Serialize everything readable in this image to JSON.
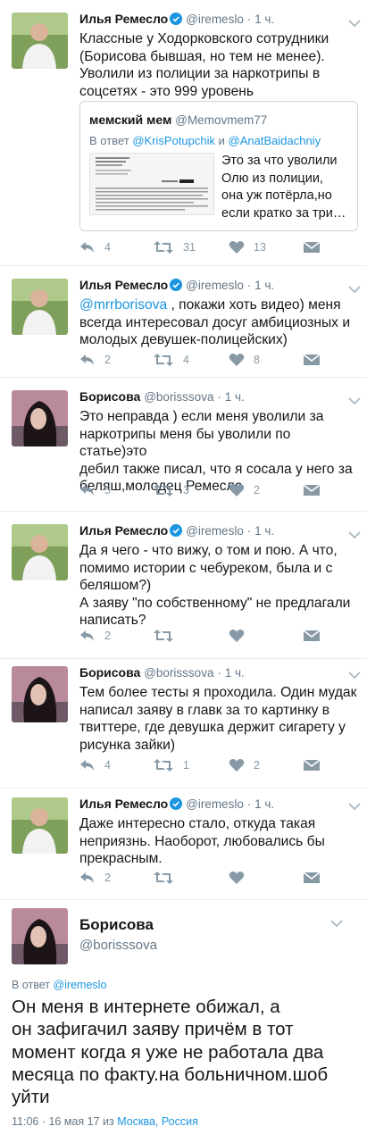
{
  "tweets": [
    {
      "name": "Илья Ремесло",
      "handle": "@iremeslo",
      "dot": "·",
      "time": "1 ч.",
      "text_lines": [
        "Классные у Ходорковского сотрудники",
        "(Борисова бывшая, но тем не менее).",
        "Уволили из полиции за наркотрипы в",
        "соцсетях - это 999 уровень"
      ],
      "counts": {
        "reply": "4",
        "retweet": "31",
        "like": "13"
      }
    },
    {
      "name": "Илья Ремесло",
      "handle": "@iremeslo",
      "dot": "·",
      "time": "1 ч.",
      "mention": "@mrrborisova",
      "text_first_rest": " , покажи хоть видео) меня",
      "text_lines": [
        "всегда интересовал досуг амбициозных и",
        "молодых девушек-полицейских)"
      ],
      "counts": {
        "reply": "2",
        "retweet": "4",
        "like": "8"
      }
    },
    {
      "name": "Борисова",
      "handle": "@borisssova",
      "dot": "·",
      "time": "1 ч.",
      "text_lines": [
        "Это неправда ) если меня уволили за",
        "наркотрипы меня бы уволили по статье)это",
        "дебил также писал, что я сосала у него за",
        "беляш,молодец Ремесло"
      ],
      "counts": {
        "reply": "5",
        "retweet": "3",
        "like": "2"
      }
    },
    {
      "name": "Илья Ремесло",
      "handle": "@iremeslo",
      "dot": "·",
      "time": "1 ч.",
      "text_lines": [
        "Да я чего - что вижу, о том и пою. А  что,",
        "помимо истории с чебуреком, была и с",
        "беляшом?)",
        "А заяву \"по собственному\" не предлагали",
        "написать?"
      ],
      "counts": {
        "reply": "2",
        "retweet": "",
        "like": ""
      }
    },
    {
      "name": "Борисова",
      "handle": "@borisssova",
      "dot": "·",
      "time": "1 ч.",
      "text_lines": [
        "Тем более тесты я проходила. Один мудак",
        "написал заяву в главк за то картинку в",
        "твиттере, где девушка держит сигарету у",
        "рисунка зайки)"
      ],
      "counts": {
        "reply": "4",
        "retweet": "1",
        "like": "2"
      }
    },
    {
      "name": "Илья Ремесло",
      "handle": "@iremeslo",
      "dot": "·",
      "time": "1 ч.",
      "text_lines": [
        "Даже интересно стало, откуда такая",
        "неприязнь. Наоборот, любовались бы",
        "прекрасным."
      ],
      "counts": {
        "reply": "2",
        "retweet": "",
        "like": ""
      }
    }
  ],
  "quote": {
    "name": "мемский мем",
    "handle": "@Memovmem77",
    "reply_prefix": "В ответ",
    "reply_user1": "@KrisPotupchik",
    "reply_and": "и",
    "reply_user2": "@AnatBaidachniy",
    "text_lines": [
      "Это за что уволили",
      "Олю из полиции,",
      "она уж потёрла,но",
      "если кратко за три…"
    ]
  },
  "main": {
    "name": "Борисова",
    "handle": "@borisssova",
    "reply_prefix": "В ответ",
    "reply_user": "@iremeslo",
    "text_lines": [
      "Он меня в интернете обижал, а",
      "он зафигачил заяву причём в тот",
      "момент когда я уже не работала два",
      "месяца по факту.на больничном.шоб",
      "уйти"
    ],
    "time": "11:06 · 16 мая 17",
    "from": "из",
    "location": "Москва, Россия"
  },
  "colors": {
    "accent": "#1b95e0",
    "muted": "#657786",
    "icon": "#8899a6"
  }
}
